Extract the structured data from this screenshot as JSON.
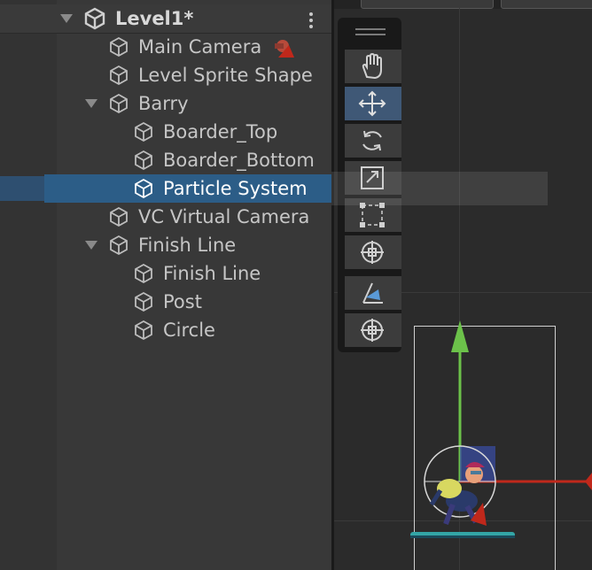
{
  "hierarchy": {
    "scene": {
      "label": "Level1*",
      "expanded": true
    },
    "items": [
      {
        "label": "Main Camera",
        "depth": 1,
        "expandable": false,
        "badge": "camera-warning-icon"
      },
      {
        "label": "Level Sprite Shape",
        "depth": 1,
        "expandable": false
      },
      {
        "label": "Barry",
        "depth": 1,
        "expandable": true,
        "expanded": true
      },
      {
        "label": "Boarder_Top",
        "depth": 2,
        "expandable": false
      },
      {
        "label": "Boarder_Bottom",
        "depth": 2,
        "expandable": false
      },
      {
        "label": "Particle System",
        "depth": 2,
        "expandable": false,
        "selected": true
      },
      {
        "label": "VC Virtual Camera",
        "depth": 1,
        "expandable": false
      },
      {
        "label": "Finish Line",
        "depth": 1,
        "expandable": true,
        "expanded": true
      },
      {
        "label": "Finish Line",
        "depth": 2,
        "expandable": false
      },
      {
        "label": "Post",
        "depth": 2,
        "expandable": false
      },
      {
        "label": "Circle",
        "depth": 2,
        "expandable": false
      }
    ]
  },
  "scene_view": {
    "tools": [
      {
        "name": "hand-tool",
        "icon": "hand-icon",
        "active": false
      },
      {
        "name": "move-tool",
        "icon": "move-icon",
        "active": true
      },
      {
        "name": "rotate-tool",
        "icon": "rotate-icon",
        "active": false
      },
      {
        "name": "scale-tool",
        "icon": "scale-icon",
        "active": false
      },
      {
        "name": "rect-tool",
        "icon": "rect-transform-icon",
        "active": false
      },
      {
        "name": "transform-tool",
        "icon": "transform-icon",
        "active": false
      },
      {
        "name": "custom-tool",
        "icon": "custom-editor-icon",
        "active": false
      },
      {
        "name": "pivot-tool",
        "icon": "pivot-icon",
        "active": false
      }
    ],
    "colors": {
      "selection": "#2c5d87",
      "gizmo_y": "#6cc24a",
      "gizmo_x": "#c0281b",
      "active_tool": "#3f5876"
    }
  }
}
